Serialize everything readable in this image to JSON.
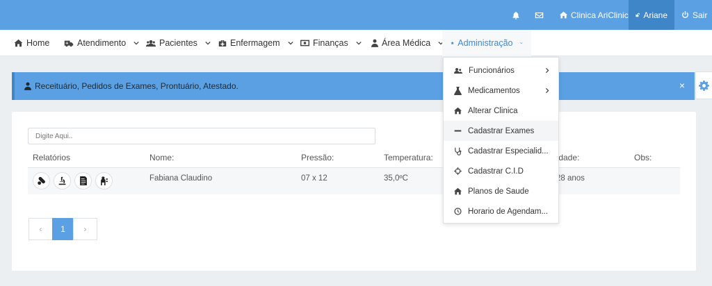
{
  "topbar": {
    "bell_icon": "bell-icon",
    "mail_icon": "envelope-icon",
    "clinic_label": "Clinica AriClinic",
    "user_label": "Ariane",
    "logout_label": "Sair"
  },
  "nav": {
    "home": "Home",
    "atendimento": "Atendimento",
    "pacientes": "Pacientes",
    "enfermagem": "Enfermagem",
    "financas": "Finanças",
    "area_medica": "Área Médica",
    "administracao": "Administração"
  },
  "alert": {
    "text": "Receituário, Pedidos de Exames, Prontuário, Atestado.",
    "close": "×"
  },
  "search": {
    "placeholder": "Digite Aqui.."
  },
  "table": {
    "headers": {
      "relatorios": "Relatórios",
      "nome": "Nome:",
      "pressao": "Pressão:",
      "temperatura": "Temperatura:",
      "idade": "Idade:",
      "obs": "Obs:"
    },
    "rows": [
      {
        "nome": "Fabiana Claudino",
        "pressao": "07 x 12",
        "temperatura": "35,0ºC",
        "idade": "28 anos",
        "obs": ""
      }
    ]
  },
  "pagination": {
    "prev": "‹",
    "current": "1",
    "next": "›"
  },
  "dropdown": {
    "items": [
      {
        "label": "Funcionários",
        "icon": "users-icon",
        "has_sub": true
      },
      {
        "label": "Medicamentos",
        "icon": "flask-icon",
        "has_sub": true
      },
      {
        "label": "Alterar Clinica",
        "icon": "home-icon",
        "has_sub": false
      },
      {
        "label": "Cadastrar Exames",
        "icon": "minus-icon",
        "has_sub": false
      },
      {
        "label": "Cadastrar Especialid...",
        "icon": "stethoscope-icon",
        "has_sub": false
      },
      {
        "label": "Cadastrar C.I.D",
        "icon": "crosshairs-icon",
        "has_sub": false
      },
      {
        "label": "Planos de Saude",
        "icon": "home-icon",
        "has_sub": false
      },
      {
        "label": "Horario de Agendam...",
        "icon": "clock-icon",
        "has_sub": false
      }
    ]
  },
  "colors": {
    "primary": "#5aa0e2",
    "primary_dark": "#3f86c8",
    "background": "#eceff1"
  }
}
